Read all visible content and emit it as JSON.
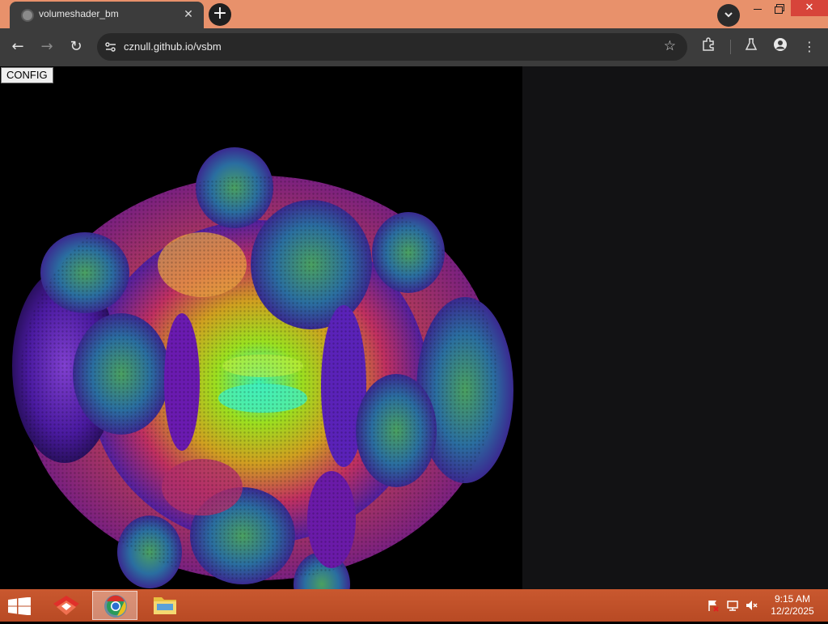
{
  "browser": {
    "tab_title": "volumeshader_bm",
    "tab_close": "✕",
    "new_tab": "+",
    "url": "cznull.github.io/vsbm",
    "back_icon": "←",
    "forward_icon": "→",
    "reload_icon": "↻",
    "star_icon": "☆",
    "extensions_icon": "puzzle-icon",
    "labs_icon": "flask-icon",
    "profile_icon": "person-icon",
    "menu_icon": "⋮",
    "window_close": "✕"
  },
  "page": {
    "config_button": "CONFIG",
    "canvas_background": "#000000",
    "side_background": "#121214"
  },
  "taskbar": {
    "time": "9:15 AM",
    "date": "12/2/2025",
    "apps": [
      "app-launcher",
      "chrome",
      "file-explorer"
    ]
  }
}
